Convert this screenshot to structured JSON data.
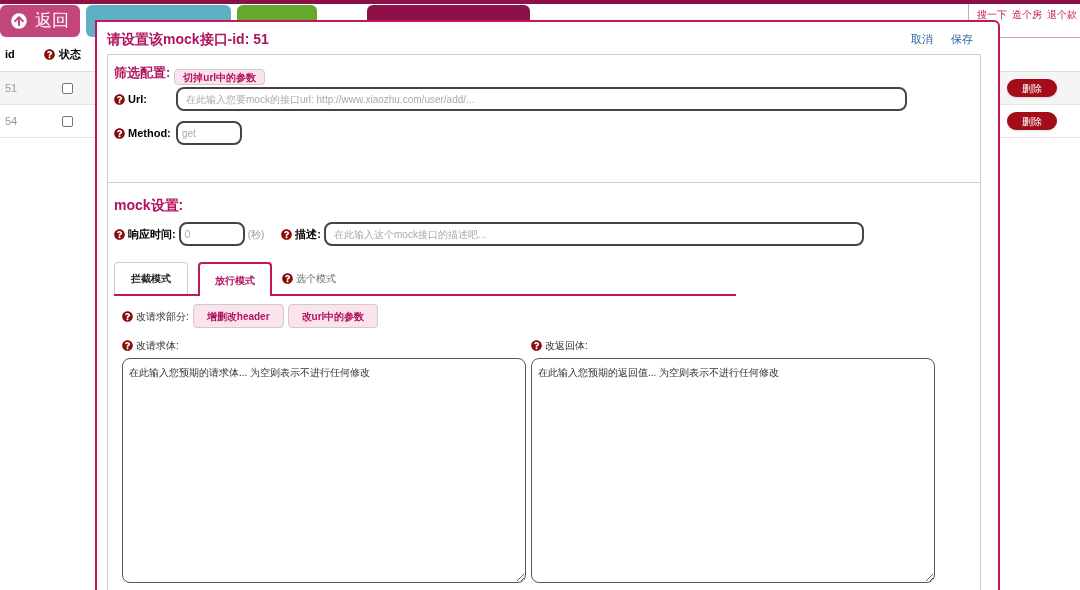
{
  "toolbar": {
    "back_button": "返回",
    "links": [
      "搜一下",
      "造个房",
      "退个款"
    ]
  },
  "table": {
    "columns": [
      "id",
      "状态"
    ],
    "rows": [
      {
        "id": "51",
        "checked": false,
        "action": "删除"
      },
      {
        "id": "54",
        "checked": false,
        "action": "删除"
      }
    ]
  },
  "dialog": {
    "title": "请设置该mock接口-id: 51",
    "actions": [
      "取消",
      "保存"
    ],
    "filter": {
      "title": "筛选配置:",
      "trim_button": "切掉url中的参数",
      "url": {
        "label": "Url:",
        "placeholder": "在此输入您要mock的接口url: http://www.xiaozhu.com/user/add/..."
      },
      "method": {
        "label": "Method:",
        "placeholder": "get"
      }
    },
    "mock": {
      "title": "mock设置:",
      "response_time": {
        "label": "响应时间:",
        "placeholder": "0",
        "unit": "(秒)"
      },
      "description": {
        "label": "描述:",
        "placeholder": "在此输入这个mock接口的描述吧..."
      },
      "tabs": [
        {
          "label": "拦截模式",
          "selected": false
        },
        {
          "label": "放行模式",
          "selected": true
        }
      ],
      "mode_hint": "选个模式",
      "request_part": {
        "label": "改请求部分:",
        "buttons": [
          "增删改header",
          "改url中的参数"
        ]
      },
      "bodies": [
        {
          "label": "改请求体:",
          "placeholder": "在此输入您预期的请求体... 为空则表示不进行任何修改"
        },
        {
          "label": "改返回体:",
          "placeholder": "在此输入您预期的返回值... 为空则表示不进行任何修改"
        }
      ]
    }
  }
}
